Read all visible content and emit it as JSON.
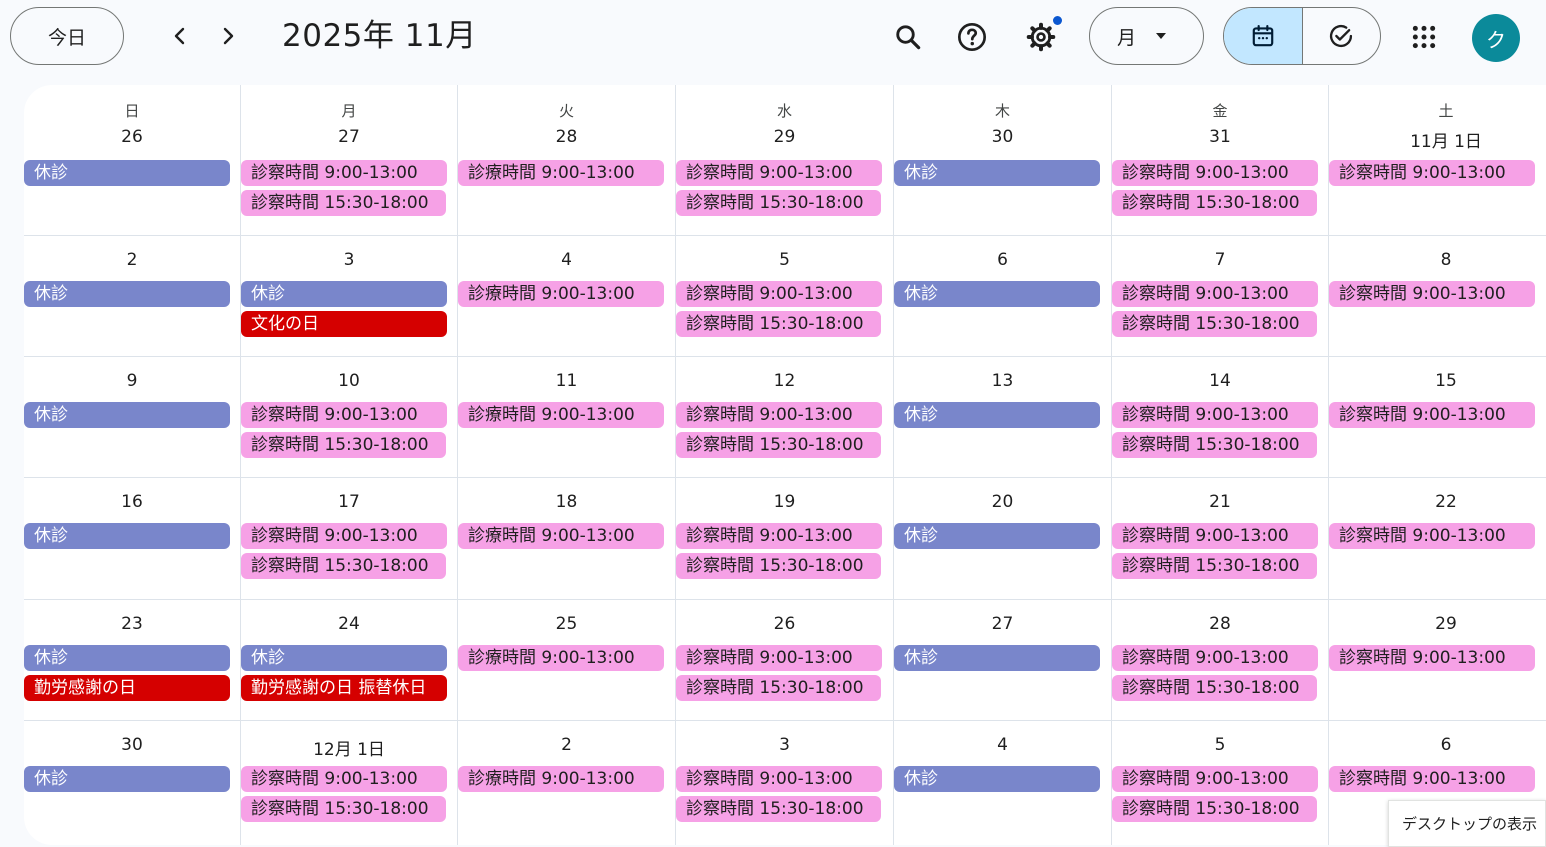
{
  "header": {
    "today_label": "今日",
    "title": "2025年 11月",
    "view_label": "月",
    "avatar_initial": "ク",
    "icons": [
      "chevron-left-icon",
      "chevron-right-icon",
      "search-icon",
      "help-icon",
      "settings-icon",
      "dropdown-arrow-icon",
      "calendar-icon",
      "task-check-icon",
      "apps-grid-icon"
    ],
    "accent_color": "#0b57d0"
  },
  "weekdays": [
    "日",
    "月",
    "火",
    "水",
    "木",
    "金",
    "土"
  ],
  "event_colors": {
    "closed": "#7986cb",
    "hours": "#f6a1e6",
    "holiday": "#d50000"
  },
  "weeks": [
    [
      {
        "day": "26",
        "events": [
          {
            "text": "休診",
            "type": "closed"
          }
        ]
      },
      {
        "day": "27",
        "events": [
          {
            "text": "診察時間 9:00-13:00",
            "type": "hours"
          },
          {
            "text": "診察時間 15:30-18:00",
            "type": "hours"
          }
        ]
      },
      {
        "day": "28",
        "events": [
          {
            "text": "診療時間 9:00-13:00",
            "type": "hours"
          }
        ]
      },
      {
        "day": "29",
        "events": [
          {
            "text": "診察時間 9:00-13:00",
            "type": "hours"
          },
          {
            "text": "診察時間 15:30-18:00",
            "type": "hours"
          }
        ]
      },
      {
        "day": "30",
        "events": [
          {
            "text": "休診",
            "type": "closed"
          }
        ]
      },
      {
        "day": "31",
        "events": [
          {
            "text": "診察時間 9:00-13:00",
            "type": "hours"
          },
          {
            "text": "診察時間 15:30-18:00",
            "type": "hours"
          }
        ]
      },
      {
        "day": "11月 1日",
        "events": [
          {
            "text": "診察時間 9:00-13:00",
            "type": "hours"
          }
        ]
      }
    ],
    [
      {
        "day": "2",
        "events": [
          {
            "text": "休診",
            "type": "closed"
          }
        ]
      },
      {
        "day": "3",
        "events": [
          {
            "text": "休診",
            "type": "closed"
          },
          {
            "text": "文化の日",
            "type": "holiday"
          }
        ]
      },
      {
        "day": "4",
        "events": [
          {
            "text": "診療時間 9:00-13:00",
            "type": "hours"
          }
        ]
      },
      {
        "day": "5",
        "events": [
          {
            "text": "診察時間 9:00-13:00",
            "type": "hours"
          },
          {
            "text": "診察時間 15:30-18:00",
            "type": "hours"
          }
        ]
      },
      {
        "day": "6",
        "events": [
          {
            "text": "休診",
            "type": "closed"
          }
        ]
      },
      {
        "day": "7",
        "events": [
          {
            "text": "診察時間 9:00-13:00",
            "type": "hours"
          },
          {
            "text": "診察時間 15:30-18:00",
            "type": "hours"
          }
        ]
      },
      {
        "day": "8",
        "events": [
          {
            "text": "診察時間 9:00-13:00",
            "type": "hours"
          }
        ]
      }
    ],
    [
      {
        "day": "9",
        "events": [
          {
            "text": "休診",
            "type": "closed"
          }
        ]
      },
      {
        "day": "10",
        "events": [
          {
            "text": "診察時間 9:00-13:00",
            "type": "hours"
          },
          {
            "text": "診察時間 15:30-18:00",
            "type": "hours"
          }
        ]
      },
      {
        "day": "11",
        "events": [
          {
            "text": "診療時間 9:00-13:00",
            "type": "hours"
          }
        ]
      },
      {
        "day": "12",
        "events": [
          {
            "text": "診察時間 9:00-13:00",
            "type": "hours"
          },
          {
            "text": "診察時間 15:30-18:00",
            "type": "hours"
          }
        ]
      },
      {
        "day": "13",
        "events": [
          {
            "text": "休診",
            "type": "closed"
          }
        ]
      },
      {
        "day": "14",
        "events": [
          {
            "text": "診察時間 9:00-13:00",
            "type": "hours"
          },
          {
            "text": "診察時間 15:30-18:00",
            "type": "hours"
          }
        ]
      },
      {
        "day": "15",
        "events": [
          {
            "text": "診察時間 9:00-13:00",
            "type": "hours"
          }
        ]
      }
    ],
    [
      {
        "day": "16",
        "events": [
          {
            "text": "休診",
            "type": "closed"
          }
        ]
      },
      {
        "day": "17",
        "events": [
          {
            "text": "診察時間 9:00-13:00",
            "type": "hours"
          },
          {
            "text": "診察時間 15:30-18:00",
            "type": "hours"
          }
        ]
      },
      {
        "day": "18",
        "events": [
          {
            "text": "診療時間 9:00-13:00",
            "type": "hours"
          }
        ]
      },
      {
        "day": "19",
        "events": [
          {
            "text": "診察時間 9:00-13:00",
            "type": "hours"
          },
          {
            "text": "診察時間 15:30-18:00",
            "type": "hours"
          }
        ]
      },
      {
        "day": "20",
        "events": [
          {
            "text": "休診",
            "type": "closed"
          }
        ]
      },
      {
        "day": "21",
        "events": [
          {
            "text": "診察時間 9:00-13:00",
            "type": "hours"
          },
          {
            "text": "診察時間 15:30-18:00",
            "type": "hours"
          }
        ]
      },
      {
        "day": "22",
        "events": [
          {
            "text": "診察時間 9:00-13:00",
            "type": "hours"
          }
        ]
      }
    ],
    [
      {
        "day": "23",
        "events": [
          {
            "text": "休診",
            "type": "closed"
          },
          {
            "text": "勤労感謝の日",
            "type": "holiday"
          }
        ]
      },
      {
        "day": "24",
        "events": [
          {
            "text": "休診",
            "type": "closed"
          },
          {
            "text": "勤労感謝の日 振替休日",
            "type": "holiday"
          }
        ]
      },
      {
        "day": "25",
        "events": [
          {
            "text": "診療時間 9:00-13:00",
            "type": "hours"
          }
        ]
      },
      {
        "day": "26",
        "events": [
          {
            "text": "診察時間 9:00-13:00",
            "type": "hours"
          },
          {
            "text": "診察時間 15:30-18:00",
            "type": "hours"
          }
        ]
      },
      {
        "day": "27",
        "events": [
          {
            "text": "休診",
            "type": "closed"
          }
        ]
      },
      {
        "day": "28",
        "events": [
          {
            "text": "診察時間 9:00-13:00",
            "type": "hours"
          },
          {
            "text": "診察時間 15:30-18:00",
            "type": "hours"
          }
        ]
      },
      {
        "day": "29",
        "events": [
          {
            "text": "診察時間 9:00-13:00",
            "type": "hours"
          }
        ]
      }
    ],
    [
      {
        "day": "30",
        "events": [
          {
            "text": "休診",
            "type": "closed"
          }
        ]
      },
      {
        "day": "12月 1日",
        "events": [
          {
            "text": "診察時間 9:00-13:00",
            "type": "hours"
          },
          {
            "text": "診察時間 15:30-18:00",
            "type": "hours"
          }
        ]
      },
      {
        "day": "2",
        "events": [
          {
            "text": "診療時間 9:00-13:00",
            "type": "hours"
          }
        ]
      },
      {
        "day": "3",
        "events": [
          {
            "text": "診察時間 9:00-13:00",
            "type": "hours"
          },
          {
            "text": "診察時間 15:30-18:00",
            "type": "hours"
          }
        ]
      },
      {
        "day": "4",
        "events": [
          {
            "text": "休診",
            "type": "closed"
          }
        ]
      },
      {
        "day": "5",
        "events": [
          {
            "text": "診察時間 9:00-13:00",
            "type": "hours"
          },
          {
            "text": "診察時間 15:30-18:00",
            "type": "hours"
          }
        ]
      },
      {
        "day": "6",
        "events": [
          {
            "text": "診察時間 9:00-13:00",
            "type": "hours"
          }
        ]
      }
    ]
  ],
  "tooltip": "デスクトップの表示"
}
